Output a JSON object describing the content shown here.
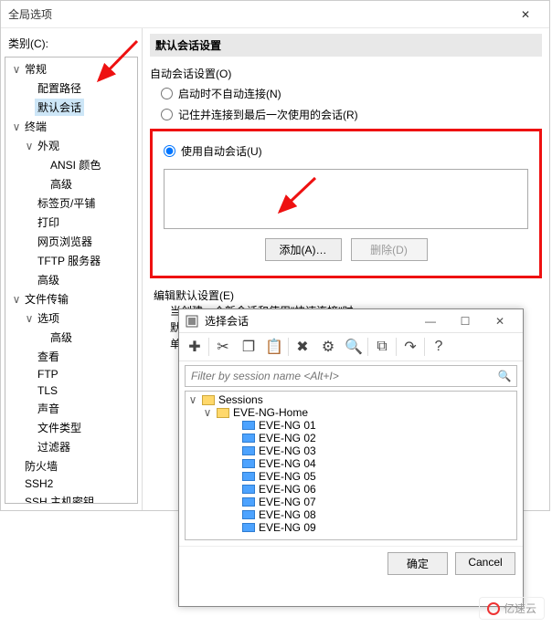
{
  "window": {
    "title": "全局选项",
    "close": "✕"
  },
  "sidebar": {
    "label": "类别(C):",
    "items": [
      {
        "label": "常规",
        "exp": "∨",
        "indent": 0
      },
      {
        "label": "配置路径",
        "indent": 1
      },
      {
        "label": "默认会话",
        "indent": 1,
        "selected": true
      },
      {
        "label": "终端",
        "exp": "∨",
        "indent": 0
      },
      {
        "label": "外观",
        "exp": "∨",
        "indent": 1
      },
      {
        "label": "ANSI 颜色",
        "indent": 2
      },
      {
        "label": "高级",
        "indent": 2
      },
      {
        "label": "标签页/平铺",
        "indent": 1
      },
      {
        "label": "打印",
        "indent": 1
      },
      {
        "label": "网页浏览器",
        "indent": 1
      },
      {
        "label": "TFTP 服务器",
        "indent": 1
      },
      {
        "label": "高级",
        "indent": 1
      },
      {
        "label": "文件传输",
        "exp": "∨",
        "indent": 0
      },
      {
        "label": "选项",
        "exp": "∨",
        "indent": 1
      },
      {
        "label": "高级",
        "indent": 2
      },
      {
        "label": "查看",
        "indent": 1
      },
      {
        "label": "FTP",
        "indent": 1
      },
      {
        "label": "TLS",
        "indent": 1
      },
      {
        "label": "声音",
        "indent": 1
      },
      {
        "label": "文件类型",
        "indent": 1
      },
      {
        "label": "过滤器",
        "indent": 1
      },
      {
        "label": "防火墙",
        "indent": 0
      },
      {
        "label": "SSH2",
        "indent": 0
      },
      {
        "label": "SSH 主机密钥",
        "indent": 0
      }
    ]
  },
  "main": {
    "group_title": "默认会话设置",
    "auto_session_label": "自动会话设置(O)",
    "radio_none": "启动时不自动连接(N)",
    "radio_last": "记住并连接到最后一次使用的会话(R)",
    "radio_auto": "使用自动会话(U)",
    "add_btn": "添加(A)…",
    "del_btn": "删除(D)",
    "edit_defaults_label": "编辑默认设置(E)",
    "desc_line1": "当创建一个新会话和使用\"快速连接\"时，",
    "desc_line2": "默认的会话设置会被使用。",
    "desc_line3": "单击下面的按钮以更改默认的设置。"
  },
  "dialog": {
    "title": "选择会话",
    "min": "—",
    "max": "☐",
    "close": "✕",
    "toolbar": {
      "add": "✚",
      "cut": "✂",
      "copy": "❐",
      "paste": "📋",
      "delete": "✖",
      "settings": "⚙",
      "find": "🔍",
      "newfolder": "⧉",
      "export": "↷",
      "help": "?"
    },
    "filter_placeholder": "Filter by session name <Alt+I>",
    "root": "Sessions",
    "folder": "EVE-NG-Home",
    "sessions": [
      "EVE-NG 01",
      "EVE-NG 02",
      "EVE-NG 03",
      "EVE-NG 04",
      "EVE-NG 05",
      "EVE-NG 06",
      "EVE-NG 07",
      "EVE-NG 08",
      "EVE-NG 09"
    ],
    "ok": "确定",
    "cancel": "Cancel"
  },
  "watermark": "亿速云"
}
